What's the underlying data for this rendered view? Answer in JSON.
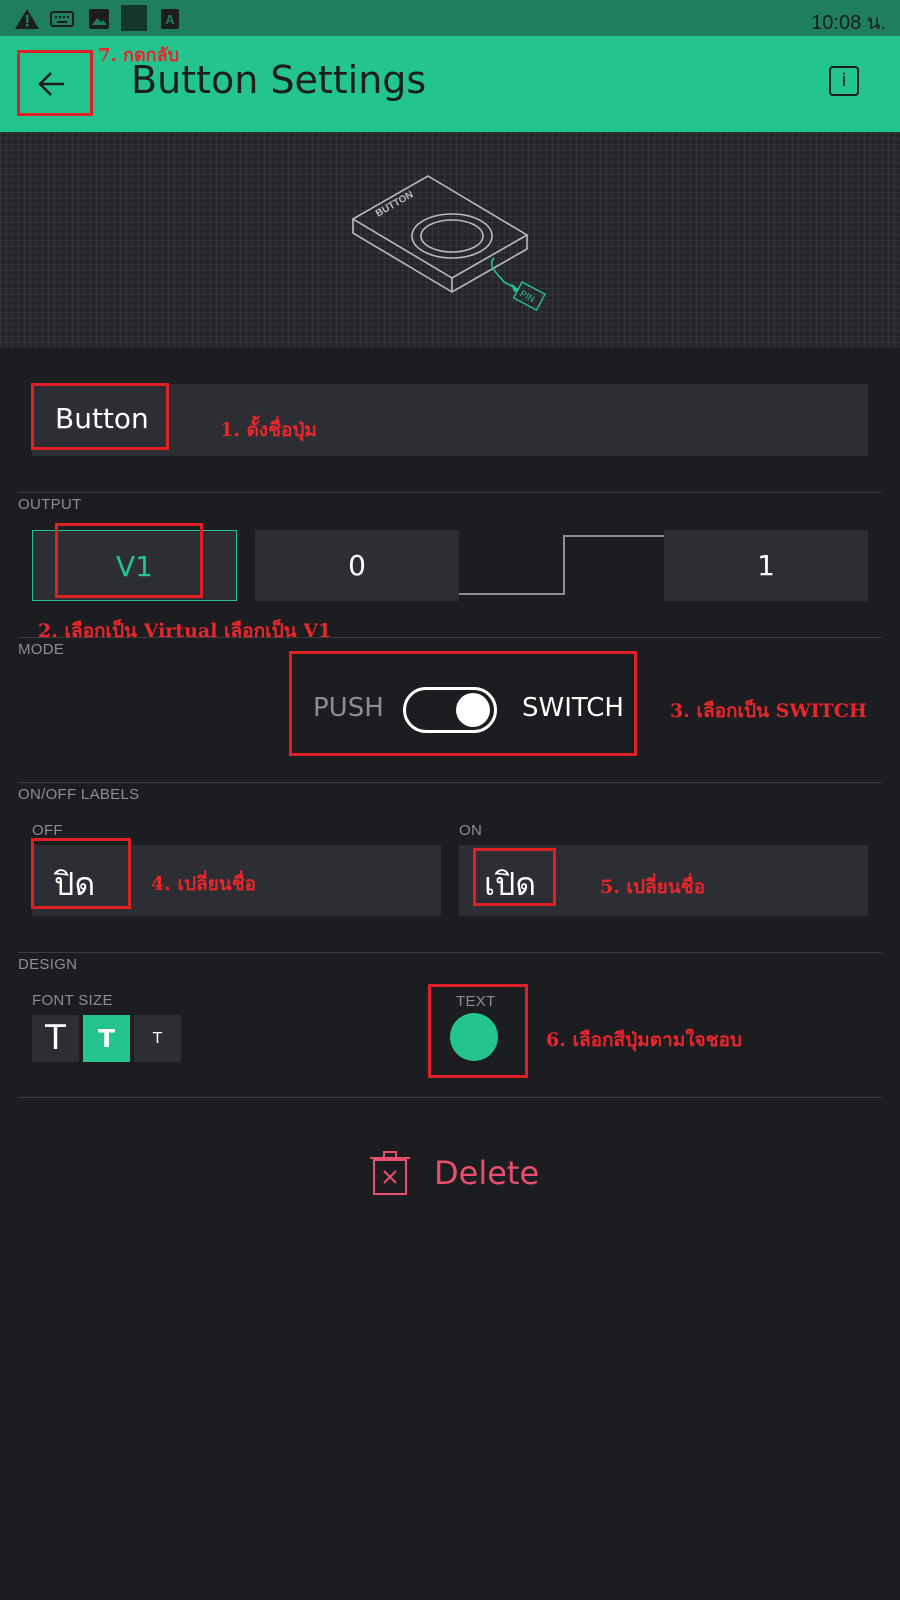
{
  "status_bar": {
    "time": "10:08 น.",
    "icons": [
      "warning-icon",
      "keyboard-icon",
      "image-icon",
      "app-icon",
      "a-icon"
    ]
  },
  "app_bar": {
    "title": "Button Settings",
    "back_icon": "arrow-left-icon",
    "info_label": "i"
  },
  "banner": {
    "device_label": "BUTTON",
    "pin_label": "PIN"
  },
  "name_field": {
    "value": "Button"
  },
  "output": {
    "label": "OUTPUT",
    "pin": "V1",
    "low_value": "0",
    "high_value": "1"
  },
  "mode": {
    "label": "MODE",
    "push_label": "PUSH",
    "switch_label": "SWITCH",
    "selected": "SWITCH"
  },
  "labels": {
    "section_label": "ON/OFF LABELS",
    "off_label": "OFF",
    "off_value": "ปิด",
    "on_label": "ON",
    "on_value": "เปิด"
  },
  "design": {
    "section_label": "DESIGN",
    "font_size_label": "FONT SIZE",
    "font_sizes": [
      "T",
      "T",
      "T"
    ],
    "selected_font_size": 1,
    "text_label": "TEXT",
    "color": "#23c48e"
  },
  "delete": {
    "label": "Delete"
  },
  "annotations": {
    "step1": "1. ตั้งชื่อปุ่ม",
    "step2": "2. เลือกเป็น Virtual เลือกเป็น V1",
    "step3": "3. เลือกเป็น SWITCH",
    "step4": "4. เปลี่ยนชื่อ",
    "step5": "5. เปลี่ยนชื่อ",
    "step6": "6. เลือกสีปุ่มตามใจชอบ",
    "step7": "7. กดกลับ"
  },
  "colors": {
    "accent": "#23c48e",
    "background": "#1c1d21",
    "field": "#2d2e33",
    "annotation": "#e02025",
    "delete": "#e94e6d"
  }
}
